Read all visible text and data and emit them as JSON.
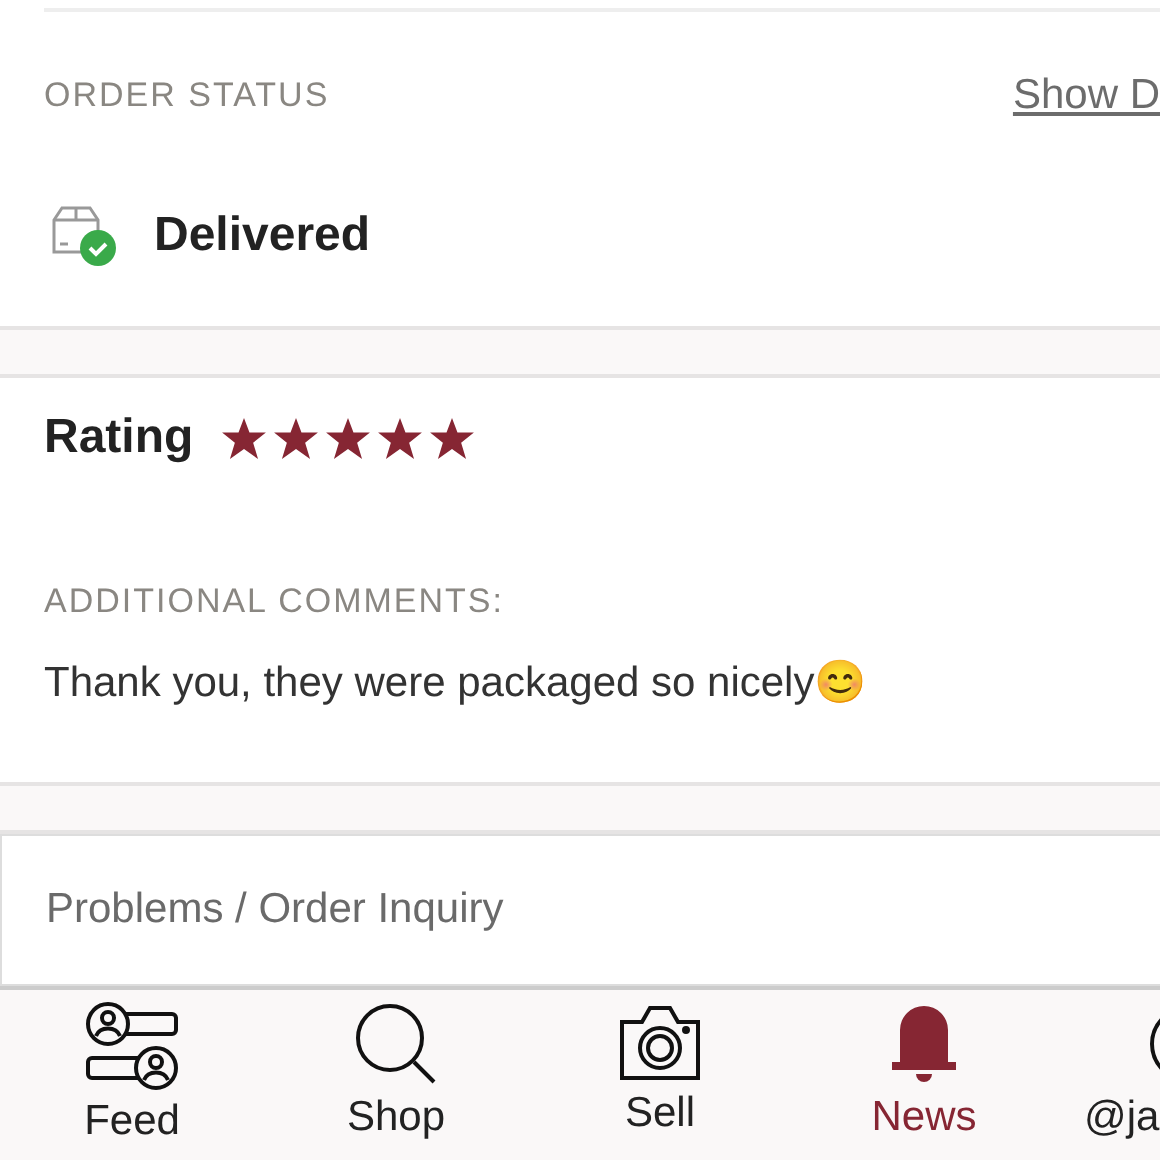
{
  "order_status": {
    "label": "ORDER STATUS",
    "link": "Show D",
    "status": "Delivered"
  },
  "rating": {
    "label": "Rating",
    "stars": 5
  },
  "comments": {
    "label": "ADDITIONAL COMMENTS:",
    "text": "Thank you, they were packaged so nicely😊"
  },
  "inquiry": {
    "label": "Problems / Order Inquiry"
  },
  "tab_bar": [
    {
      "kind": "feed",
      "label": "Feed",
      "selected": false
    },
    {
      "kind": "shop",
      "label": "Shop",
      "selected": false
    },
    {
      "kind": "sell",
      "label": "Sell",
      "selected": false
    },
    {
      "kind": "news",
      "label": "News",
      "selected": true
    },
    {
      "kind": "profile",
      "label": "@ja",
      "selected": false
    }
  ]
}
